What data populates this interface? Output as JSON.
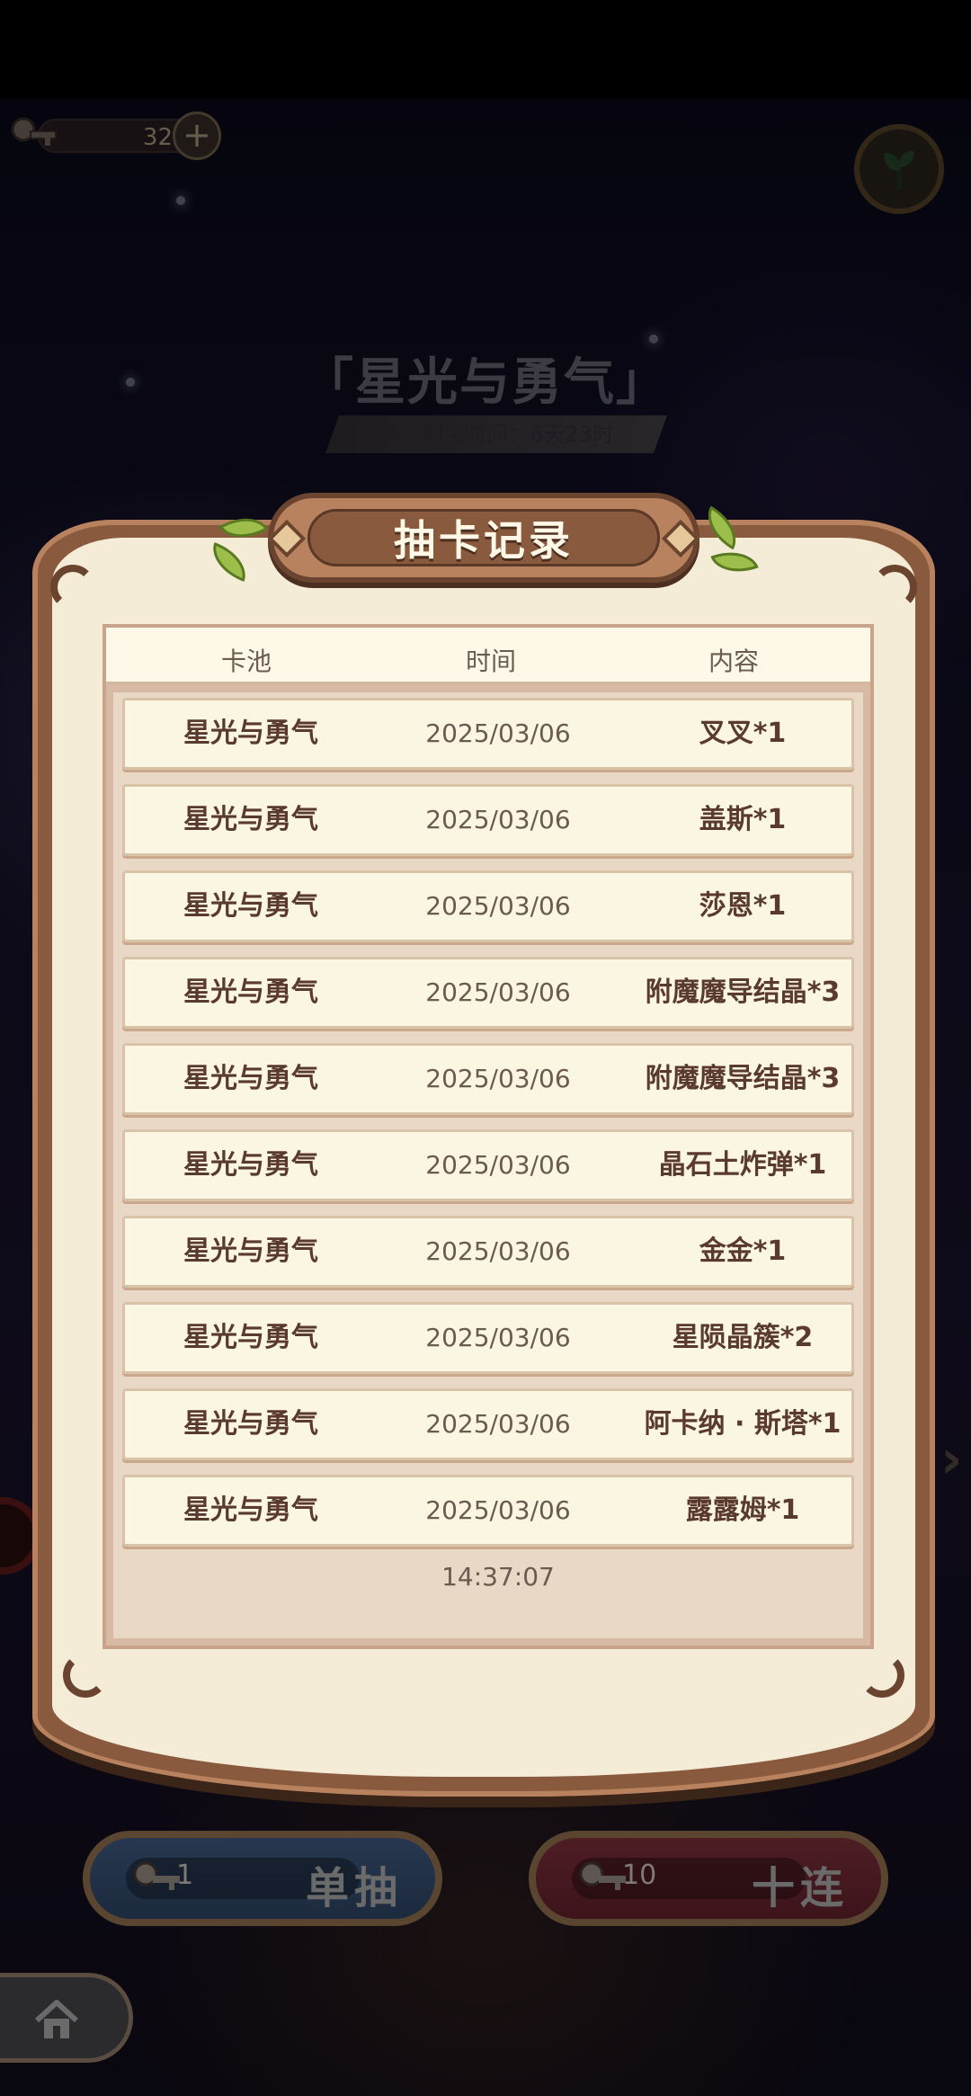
{
  "top_bar": {
    "key_count": "32",
    "plus_label": "+"
  },
  "event": {
    "title": "「星光与勇气」",
    "time_remaining": "活动剩余时间：6天23时"
  },
  "modal": {
    "title": "抽卡记录",
    "headers": {
      "pool": "卡池",
      "time": "时间",
      "content": "内容"
    },
    "rows": [
      {
        "pool": "星光与勇气",
        "time": "2025/03/06 14:37:07",
        "content": "叉叉*1"
      },
      {
        "pool": "星光与勇气",
        "time": "2025/03/06 14:37:07",
        "content": "盖斯*1"
      },
      {
        "pool": "星光与勇气",
        "time": "2025/03/06 14:37:07",
        "content": "莎恩*1"
      },
      {
        "pool": "星光与勇气",
        "time": "2025/03/06 14:37:07",
        "content": "附魔魔导结晶*3"
      },
      {
        "pool": "星光与勇气",
        "time": "2025/03/06 14:37:07",
        "content": "附魔魔导结晶*3"
      },
      {
        "pool": "星光与勇气",
        "time": "2025/03/06 14:37:07",
        "content": "晶石土炸弹*1"
      },
      {
        "pool": "星光与勇气",
        "time": "2025/03/06 14:37:07",
        "content": "金金*1"
      },
      {
        "pool": "星光与勇气",
        "time": "2025/03/06 14:37:07",
        "content": "星陨晶簇*2"
      },
      {
        "pool": "星光与勇气",
        "time": "2025/03/06 14:37:07",
        "content": "阿卡纳 · 斯塔*1"
      },
      {
        "pool": "星光与勇气",
        "time": "2025/03/06 14:37:07",
        "content": "露露姆*1"
      }
    ]
  },
  "bottom": {
    "single": {
      "count": "1",
      "label": "单抽"
    },
    "ten": {
      "count": "10",
      "label": "十连"
    }
  },
  "colors": {
    "frame": "#8a5a3e",
    "parchment": "#f4ecd7",
    "text_dark": "#5b3a2e"
  }
}
